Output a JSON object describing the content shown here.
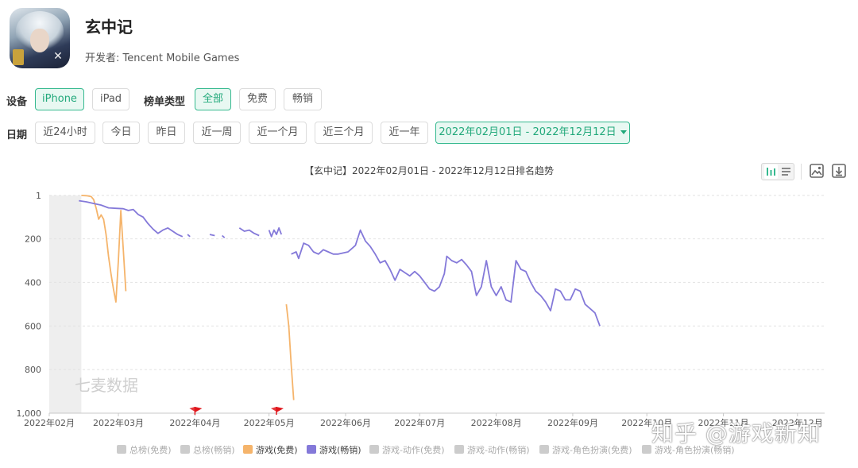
{
  "app": {
    "title": "玄中记",
    "developer": "开发者: Tencent Mobile Games"
  },
  "filters": {
    "device_label": "设备",
    "devices": [
      "iPhone",
      "iPad"
    ],
    "device_selected": "iPhone",
    "chart_type_label": "榜单类型",
    "chart_types": [
      "全部",
      "免费",
      "畅销"
    ],
    "chart_type_selected": "全部",
    "date_label": "日期",
    "date_presets": [
      "近24小时",
      "今日",
      "昨日",
      "近一周",
      "近一个月",
      "近三个月",
      "近一年"
    ],
    "date_range": "2022年02月01日 - 2022年12月12日"
  },
  "toolbar": {
    "icons": [
      "bar-chart-icon",
      "list-icon",
      "image-icon",
      "download-icon"
    ]
  },
  "watermarks": {
    "chart": "七麦数据",
    "site": "知乎 @游戏新知"
  },
  "colors": {
    "free": "#f5b46b",
    "grossing": "#8479d9",
    "accent": "#35b98f",
    "inactive_legend": "#cccccc",
    "flag": "#e0161c"
  },
  "chart_data": {
    "type": "line",
    "title": "【玄中记】2022年02月01日 - 2022年12月12日排名趋势",
    "x_ticks": [
      "2022年02月",
      "2022年03月",
      "2022年04月",
      "2022年05月",
      "2022年06月",
      "2022年07月",
      "2022年08月",
      "2022年09月",
      "2022年10月",
      "2022年11月",
      "2022年12月"
    ],
    "y_ticks": [
      "1",
      "200",
      "400",
      "600",
      "800",
      "1,000"
    ],
    "y_inverted": true,
    "ylim": [
      1,
      1000
    ],
    "xlim": [
      "2022-02-01",
      "2022-12-12"
    ],
    "shaded_range": [
      "2022-02-01",
      "2022-02-14"
    ],
    "flags": [
      "2022-04-01",
      "2022-05-04"
    ],
    "legend": [
      {
        "name": "总榜(免费)",
        "active": false
      },
      {
        "name": "总榜(畅销)",
        "active": false
      },
      {
        "name": "游戏(免费)",
        "active": true,
        "color": "#f5b46b"
      },
      {
        "name": "游戏(畅销)",
        "active": true,
        "color": "#8479d9"
      },
      {
        "name": "游戏-动作(免费)",
        "active": false
      },
      {
        "name": "游戏-动作(畅销)",
        "active": false
      },
      {
        "name": "游戏-角色扮演(免费)",
        "active": false
      },
      {
        "name": "游戏-角色扮演(畅销)",
        "active": false
      }
    ],
    "series": [
      {
        "name": "游戏(免费)",
        "segments": [
          [
            [
              "2022-02-14",
              1
            ],
            [
              "2022-02-16",
              2
            ],
            [
              "2022-02-18",
              6
            ],
            [
              "2022-02-19",
              20
            ],
            [
              "2022-02-20",
              60
            ],
            [
              "2022-02-21",
              110
            ],
            [
              "2022-02-22",
              90
            ],
            [
              "2022-02-23",
              110
            ],
            [
              "2022-02-24",
              180
            ],
            [
              "2022-02-25",
              280
            ],
            [
              "2022-02-26",
              360
            ],
            [
              "2022-02-27",
              430
            ],
            [
              "2022-02-28",
              490
            ],
            [
              "2022-03-01",
              300
            ],
            [
              "2022-03-02",
              70
            ],
            [
              "2022-03-03",
              250
            ],
            [
              "2022-03-04",
              440
            ]
          ],
          [
            [
              "2022-05-08",
              500
            ],
            [
              "2022-05-09",
              600
            ],
            [
              "2022-05-10",
              780
            ],
            [
              "2022-05-11",
              940
            ]
          ]
        ]
      },
      {
        "name": "游戏(畅销)",
        "segments": [
          [
            [
              "2022-02-13",
              25
            ],
            [
              "2022-02-16",
              30
            ],
            [
              "2022-02-19",
              38
            ],
            [
              "2022-02-22",
              45
            ],
            [
              "2022-02-25",
              58
            ],
            [
              "2022-02-28",
              60
            ],
            [
              "2022-03-03",
              62
            ],
            [
              "2022-03-05",
              70
            ],
            [
              "2022-03-07",
              65
            ],
            [
              "2022-03-09",
              88
            ],
            [
              "2022-03-11",
              100
            ],
            [
              "2022-03-13",
              130
            ],
            [
              "2022-03-15",
              155
            ],
            [
              "2022-03-17",
              175
            ],
            [
              "2022-03-19",
              160
            ],
            [
              "2022-03-21",
              150
            ],
            [
              "2022-03-23",
              165
            ],
            [
              "2022-03-25",
              180
            ],
            [
              "2022-03-27",
              190
            ]
          ],
          [
            [
              "2022-03-29",
              180
            ],
            [
              "2022-03-30",
              190
            ]
          ],
          [
            [
              "2022-04-07",
              180
            ],
            [
              "2022-04-09",
              185
            ]
          ],
          [
            [
              "2022-04-12",
              185
            ],
            [
              "2022-04-13",
              195
            ]
          ],
          [
            [
              "2022-04-19",
              150
            ],
            [
              "2022-04-21",
              165
            ],
            [
              "2022-04-23",
              160
            ],
            [
              "2022-04-25",
              175
            ],
            [
              "2022-04-27",
              185
            ]
          ],
          [
            [
              "2022-05-01",
              160
            ],
            [
              "2022-05-02",
              190
            ],
            [
              "2022-05-03",
              160
            ],
            [
              "2022-05-04",
              180
            ],
            [
              "2022-05-05",
              150
            ],
            [
              "2022-05-06",
              180
            ]
          ],
          [
            [
              "2022-05-10",
              270
            ],
            [
              "2022-05-12",
              260
            ],
            [
              "2022-05-13",
              290
            ],
            [
              "2022-05-15",
              220
            ],
            [
              "2022-05-17",
              230
            ],
            [
              "2022-05-19",
              260
            ],
            [
              "2022-05-21",
              270
            ],
            [
              "2022-05-23",
              250
            ],
            [
              "2022-05-25",
              260
            ],
            [
              "2022-05-27",
              270
            ],
            [
              "2022-05-29",
              270
            ],
            [
              "2022-05-31",
              265
            ],
            [
              "2022-06-02",
              260
            ],
            [
              "2022-06-03",
              250
            ],
            [
              "2022-06-05",
              230
            ],
            [
              "2022-06-07",
              160
            ],
            [
              "2022-06-09",
              210
            ],
            [
              "2022-06-11",
              235
            ],
            [
              "2022-06-13",
              270
            ],
            [
              "2022-06-15",
              310
            ],
            [
              "2022-06-17",
              300
            ],
            [
              "2022-06-19",
              340
            ],
            [
              "2022-06-21",
              390
            ],
            [
              "2022-06-23",
              340
            ],
            [
              "2022-06-25",
              355
            ],
            [
              "2022-06-27",
              370
            ],
            [
              "2022-06-29",
              350
            ],
            [
              "2022-07-01",
              370
            ],
            [
              "2022-07-03",
              400
            ],
            [
              "2022-07-05",
              430
            ],
            [
              "2022-07-07",
              440
            ],
            [
              "2022-07-09",
              420
            ],
            [
              "2022-07-11",
              360
            ],
            [
              "2022-07-12",
              280
            ],
            [
              "2022-07-14",
              300
            ],
            [
              "2022-07-16",
              310
            ],
            [
              "2022-07-18",
              295
            ],
            [
              "2022-07-20",
              320
            ],
            [
              "2022-07-22",
              350
            ],
            [
              "2022-07-24",
              460
            ],
            [
              "2022-07-26",
              420
            ],
            [
              "2022-07-28",
              300
            ],
            [
              "2022-07-30",
              420
            ],
            [
              "2022-08-01",
              460
            ],
            [
              "2022-08-03",
              420
            ],
            [
              "2022-08-05",
              480
            ],
            [
              "2022-08-07",
              490
            ],
            [
              "2022-08-09",
              300
            ],
            [
              "2022-08-11",
              340
            ],
            [
              "2022-08-13",
              350
            ],
            [
              "2022-08-15",
              400
            ],
            [
              "2022-08-17",
              440
            ],
            [
              "2022-08-19",
              460
            ],
            [
              "2022-08-21",
              490
            ],
            [
              "2022-08-23",
              530
            ],
            [
              "2022-08-25",
              430
            ],
            [
              "2022-08-27",
              440
            ],
            [
              "2022-08-29",
              480
            ],
            [
              "2022-08-31",
              480
            ],
            [
              "2022-09-02",
              430
            ],
            [
              "2022-09-04",
              440
            ],
            [
              "2022-09-06",
              500
            ],
            [
              "2022-09-08",
              520
            ],
            [
              "2022-09-10",
              540
            ],
            [
              "2022-09-12",
              600
            ]
          ]
        ]
      }
    ]
  }
}
